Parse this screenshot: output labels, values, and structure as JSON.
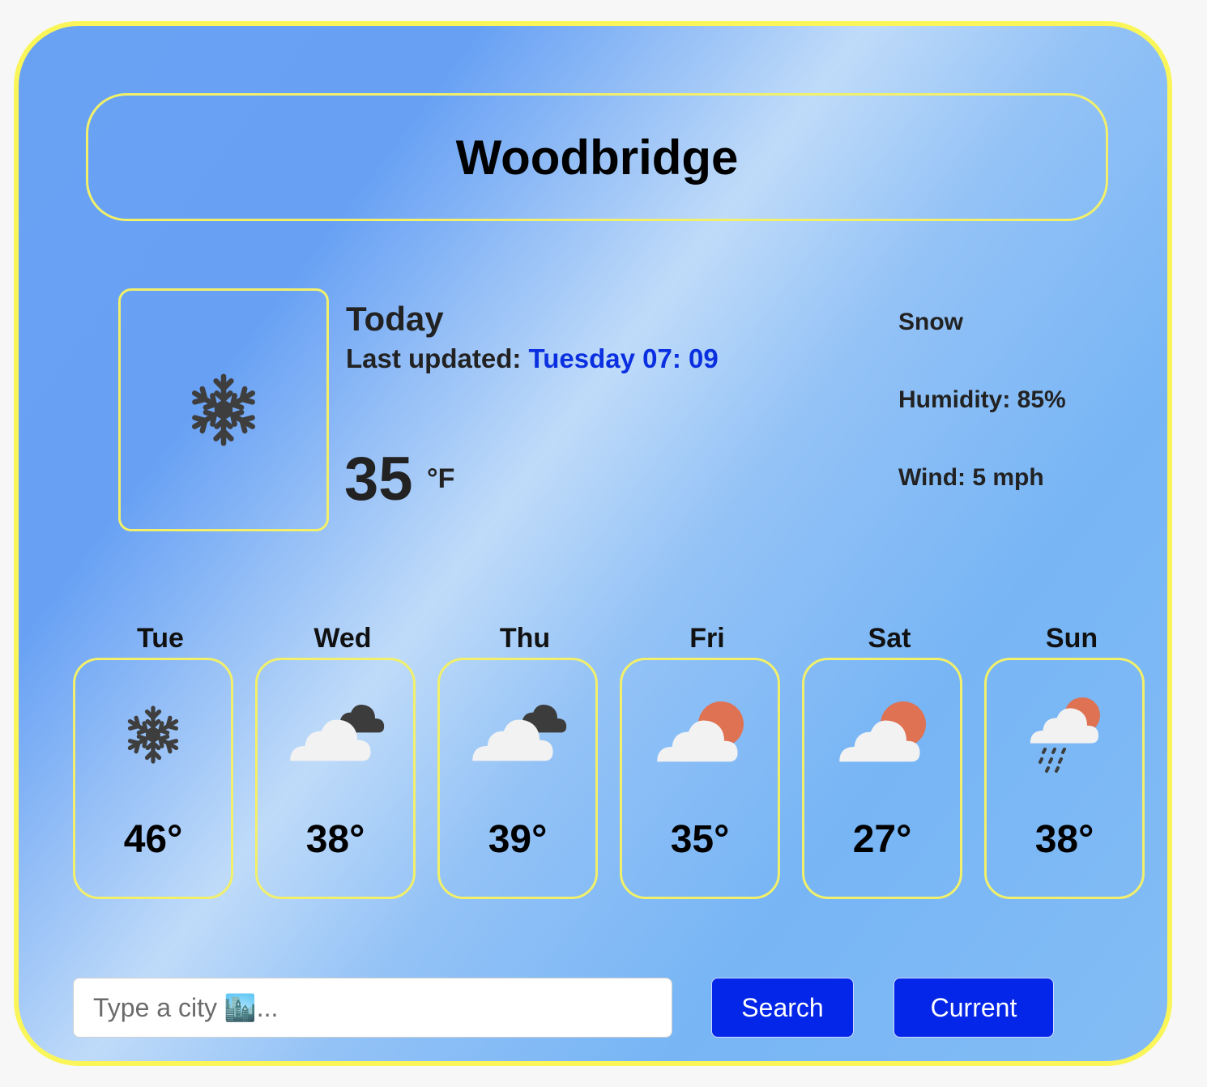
{
  "city": "Woodbridge",
  "current": {
    "icon": "snowflake-icon",
    "day_label": "Today",
    "updated_label": "Last updated:",
    "updated_time": "Tuesday 07: 09",
    "temperature": "35",
    "unit": "°F",
    "condition": "Snow",
    "humidity": "Humidity: 85%",
    "wind": "Wind: 5 mph"
  },
  "forecast": [
    {
      "day": "Tue",
      "icon": "snowflake-icon",
      "temp": "46°"
    },
    {
      "day": "Wed",
      "icon": "dark-clouds-icon",
      "temp": "38°"
    },
    {
      "day": "Thu",
      "icon": "dark-clouds-icon",
      "temp": "39°"
    },
    {
      "day": "Fri",
      "icon": "sun-behind-cloud-icon",
      "temp": "35°"
    },
    {
      "day": "Sat",
      "icon": "sun-behind-cloud-icon",
      "temp": "27°"
    },
    {
      "day": "Sun",
      "icon": "sun-cloud-rain-icon",
      "temp": "38°"
    }
  ],
  "search": {
    "placeholder": "Type a city 🏙️...",
    "search_label": "Search",
    "current_label": "Current"
  },
  "colors": {
    "card_border": "#faf65a",
    "button_bg": "#0426e8",
    "updated_time": "#0a2fe0",
    "sun": "#df7252",
    "cloud": "#f2f2f2",
    "dark_cloud": "#3c3c3c",
    "snowflake": "#3e3e3e"
  }
}
